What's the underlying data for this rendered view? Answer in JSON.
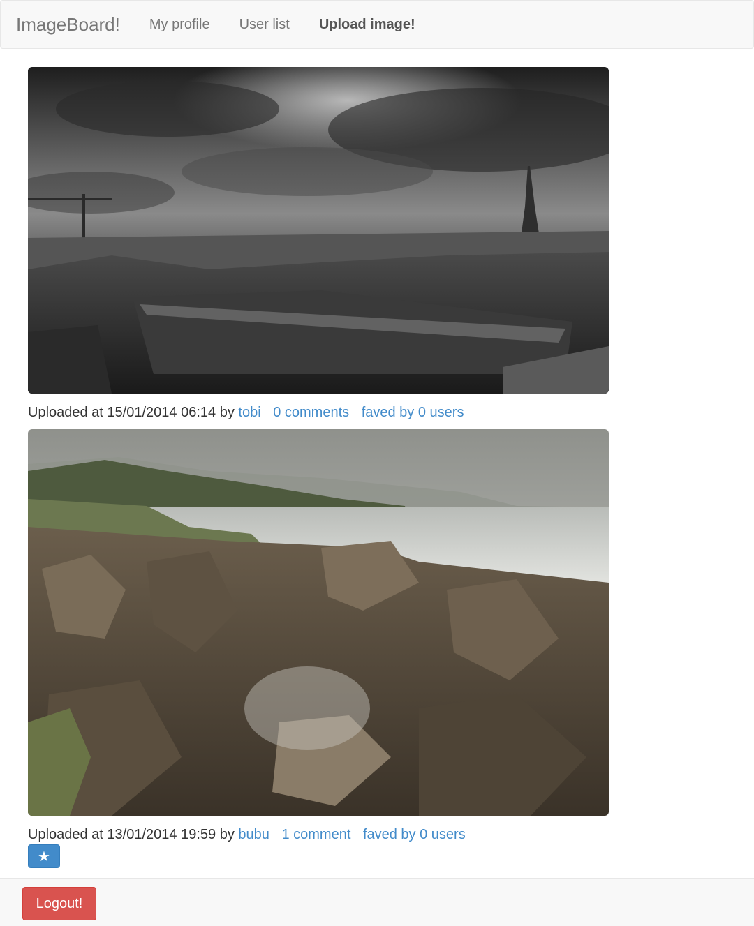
{
  "navbar": {
    "brand": "ImageBoard!",
    "links": [
      {
        "label": "My profile",
        "active": false
      },
      {
        "label": "User list",
        "active": false
      },
      {
        "label": "Upload image!",
        "active": true
      }
    ]
  },
  "posts": [
    {
      "uploaded_prefix": "Uploaded at",
      "date": "15/01/2014 06:14",
      "by_label": "by",
      "author": "tobi",
      "comments": "0 comments",
      "faved": "faved by 0 users",
      "image_subject": "black-and-white Paris rooftops with Eiffel Tower under stormy sky",
      "show_fav_button": false
    },
    {
      "uploaded_prefix": "Uploaded at",
      "date": "13/01/2014 19:59",
      "by_label": "by",
      "author": "bubu",
      "comments": "1 comment",
      "faved": "faved by 0 users",
      "image_subject": "layered coastal rock formations with sea spray",
      "show_fav_button": true,
      "fav_button_icon": "star-icon",
      "fav_button_glyph": "★"
    }
  ],
  "footer": {
    "logout_label": "Logout!"
  },
  "colors": {
    "link": "#428bca",
    "primary_button": "#428bca",
    "danger_button": "#d9534f",
    "navbar_bg": "#f8f8f8"
  }
}
